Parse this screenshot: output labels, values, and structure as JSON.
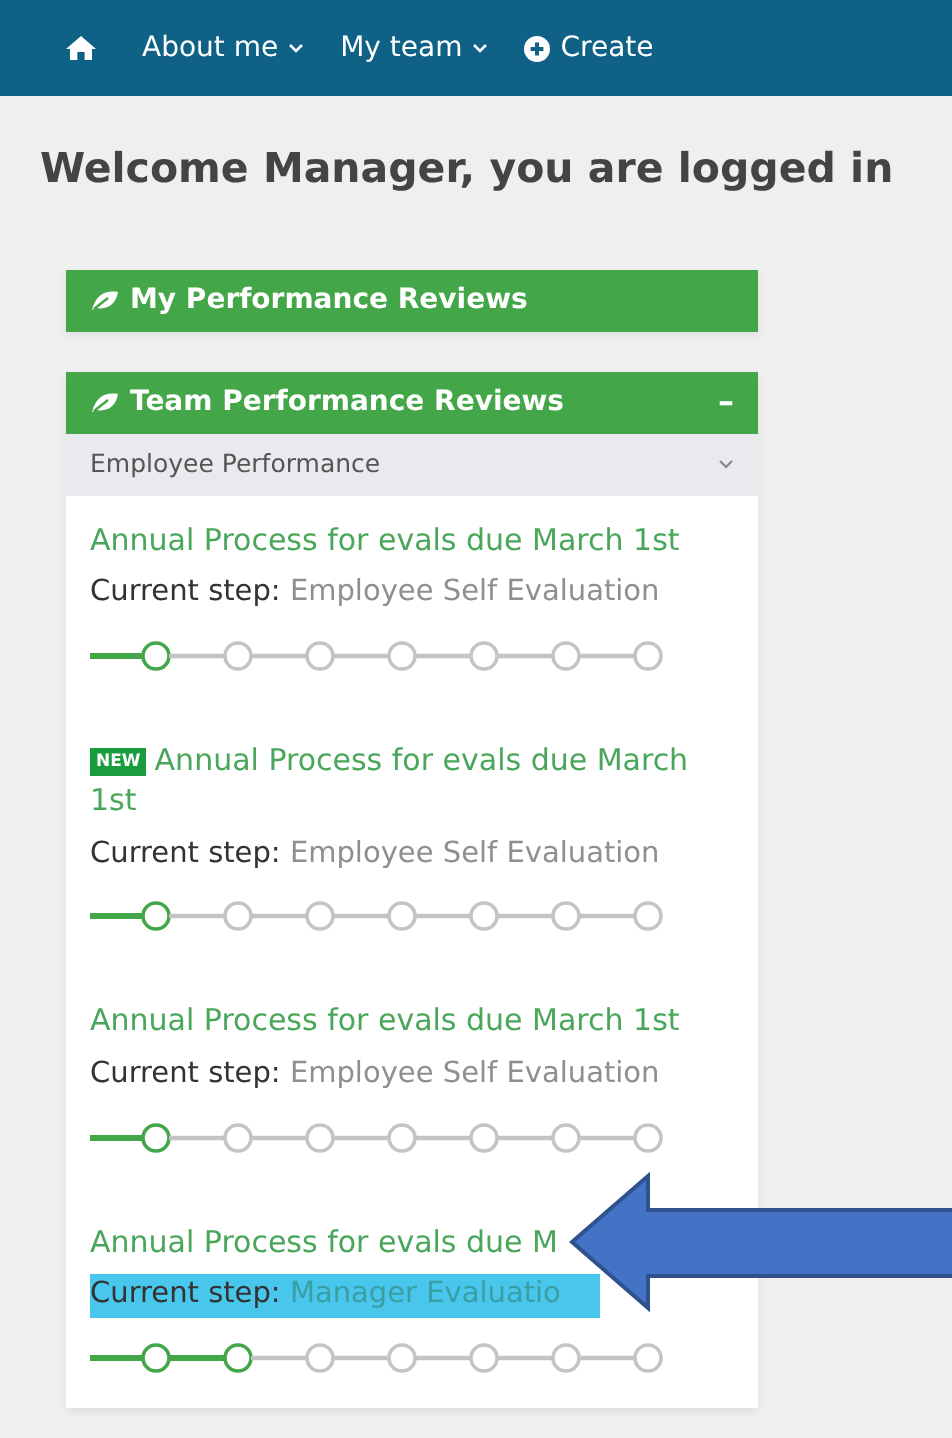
{
  "navbar": {
    "items": [
      {
        "kind": "home"
      },
      {
        "kind": "dropdown",
        "label": "About me"
      },
      {
        "kind": "dropdown",
        "label": "My team"
      },
      {
        "kind": "create",
        "label": "Create"
      }
    ]
  },
  "heading": "Welcome Manager, you are logged in",
  "panels": [
    {
      "title": "My Performance Reviews",
      "expanded": false
    },
    {
      "title": "Team Performance Reviews",
      "expanded": true,
      "collapse_symbol": "–",
      "filter": {
        "value": "Employee Performance"
      },
      "reviews": [
        {
          "title": "Annual Process for evals due March 1st",
          "new": false,
          "step_label": "Current step:",
          "step": "Employee Self Evaluation",
          "highlighted": false,
          "steps": [
            {
              "reached": true
            },
            {
              "reached": false
            },
            {
              "reached": false
            },
            {
              "reached": false
            },
            {
              "reached": false
            },
            {
              "reached": false
            },
            {
              "reached": false
            }
          ]
        },
        {
          "title": "Annual Process for evals due March 1st",
          "new": true,
          "badge": "NEW",
          "step_label": "Current step:",
          "step": "Employee Self Evaluation",
          "highlighted": false,
          "steps": [
            {
              "reached": true
            },
            {
              "reached": false
            },
            {
              "reached": false
            },
            {
              "reached": false
            },
            {
              "reached": false
            },
            {
              "reached": false
            },
            {
              "reached": false
            }
          ]
        },
        {
          "title": "Annual Process for evals due March 1st",
          "new": false,
          "step_label": "Current step:",
          "step": "Employee Self Evaluation",
          "highlighted": false,
          "steps": [
            {
              "reached": true
            },
            {
              "reached": false
            },
            {
              "reached": false
            },
            {
              "reached": false
            },
            {
              "reached": false
            },
            {
              "reached": false
            },
            {
              "reached": false
            }
          ]
        },
        {
          "title": "Annual Process for evals due M",
          "new": false,
          "step_label": "Current step:",
          "step": "Manager Evaluatio",
          "highlighted": true,
          "steps": [
            {
              "reached": true
            },
            {
              "reached": true
            },
            {
              "reached": false
            },
            {
              "reached": false
            },
            {
              "reached": false
            },
            {
              "reached": false
            },
            {
              "reached": false
            }
          ]
        }
      ]
    }
  ],
  "annotation": {
    "kind": "arrow"
  }
}
